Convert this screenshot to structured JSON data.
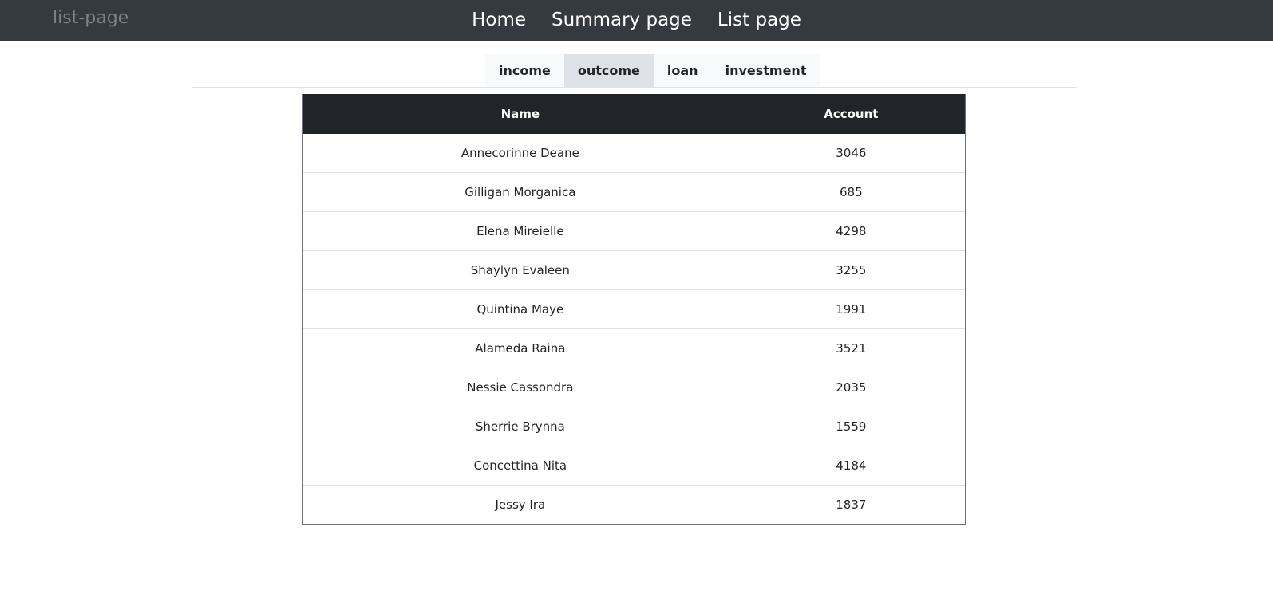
{
  "navbar": {
    "brand": "list-page",
    "links": [
      "Home",
      "Summary page",
      "List page"
    ]
  },
  "tabs": {
    "items": [
      "income",
      "outcome",
      "loan",
      "investment"
    ],
    "active": "outcome"
  },
  "table": {
    "columns": [
      "Name",
      "Account"
    ],
    "rows": [
      {
        "name": "Annecorinne Deane",
        "account": "3046"
      },
      {
        "name": "Gilligan Morganica",
        "account": "685"
      },
      {
        "name": "Elena Mireielle",
        "account": "4298"
      },
      {
        "name": "Shaylyn Evaleen",
        "account": "3255"
      },
      {
        "name": "Quintina Maye",
        "account": "1991"
      },
      {
        "name": "Alameda Raina",
        "account": "3521"
      },
      {
        "name": "Nessie Cassondra",
        "account": "2035"
      },
      {
        "name": "Sherrie Brynna",
        "account": "1559"
      },
      {
        "name": "Concettina Nita",
        "account": "4184"
      },
      {
        "name": "Jessy Ira",
        "account": "1837"
      }
    ]
  }
}
